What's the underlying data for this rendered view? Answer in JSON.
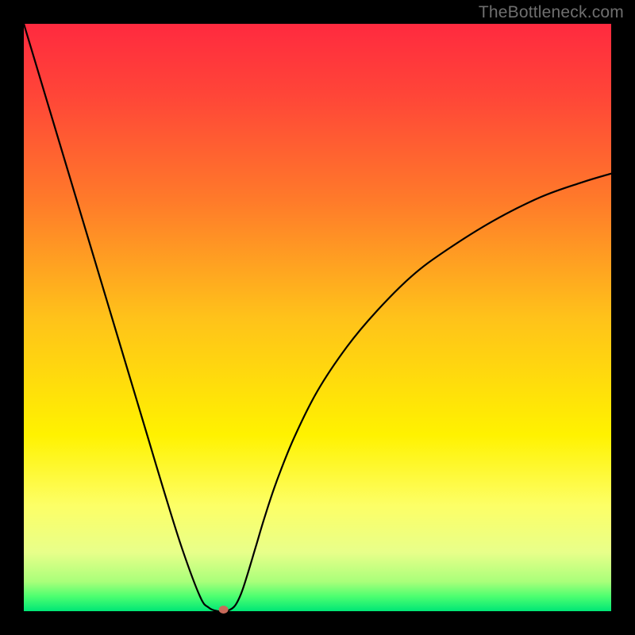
{
  "watermark": "TheBottleneck.com",
  "chart_data": {
    "type": "line",
    "title": "",
    "xlabel": "",
    "ylabel": "",
    "xlim": [
      0,
      100
    ],
    "ylim": [
      0,
      100
    ],
    "grid": false,
    "legend": false,
    "background_gradient": {
      "type": "vertical",
      "stops": [
        {
          "offset": 0.0,
          "color": "#ff2a3f"
        },
        {
          "offset": 0.12,
          "color": "#ff4538"
        },
        {
          "offset": 0.3,
          "color": "#ff7a2a"
        },
        {
          "offset": 0.5,
          "color": "#ffc21a"
        },
        {
          "offset": 0.7,
          "color": "#fff200"
        },
        {
          "offset": 0.82,
          "color": "#fdff66"
        },
        {
          "offset": 0.9,
          "color": "#e8ff8a"
        },
        {
          "offset": 0.95,
          "color": "#a9ff7a"
        },
        {
          "offset": 0.975,
          "color": "#4cff70"
        },
        {
          "offset": 1.0,
          "color": "#00e676"
        }
      ]
    },
    "series": [
      {
        "name": "bottleneck-curve",
        "x": [
          0.0,
          3.0,
          6.0,
          9.0,
          12.0,
          15.0,
          18.0,
          21.0,
          24.0,
          27.0,
          30.0,
          31.5,
          33.0,
          34.0,
          35.0,
          36.0,
          37.0,
          38.0,
          39.5,
          41.0,
          43.0,
          46.0,
          50.0,
          55.0,
          60.0,
          66.0,
          72.0,
          80.0,
          88.0,
          95.0,
          100.0
        ],
        "y": [
          100.0,
          90.0,
          80.0,
          70.0,
          60.0,
          50.0,
          40.0,
          30.0,
          20.0,
          10.5,
          2.5,
          0.6,
          0.0,
          0.0,
          0.2,
          1.0,
          3.0,
          6.0,
          11.0,
          16.0,
          22.0,
          29.5,
          37.5,
          45.0,
          51.0,
          57.0,
          61.5,
          66.5,
          70.5,
          73.0,
          74.5
        ]
      }
    ],
    "marker": {
      "name": "optimal-point",
      "x": 34.0,
      "y": 0.0,
      "color": "#c96a5a",
      "rx": 6,
      "ry": 5
    }
  }
}
